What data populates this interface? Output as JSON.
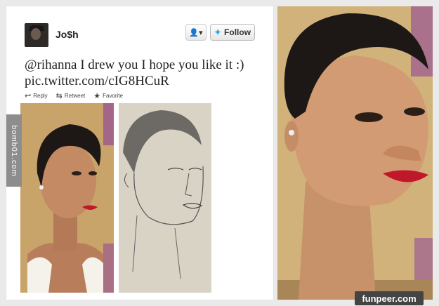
{
  "tweet": {
    "username": "Jo$h",
    "follow_label": "Follow",
    "user_menu_icon": "person-dropdown-icon",
    "text_line1": "@rihanna I drew you I hope you like it :)",
    "text_line2": "pic.twitter.com/cIG8HCuR",
    "actions": {
      "reply": "Reply",
      "retweet": "Retweet",
      "favorite": "Favorite"
    }
  },
  "side_watermark": "bomb01.com",
  "brand_watermark": "funpeer.com",
  "colors": {
    "follow_bird": "#2aa9e0",
    "lips": "#c0182a",
    "mtv_purple": "#8a3c9c"
  }
}
